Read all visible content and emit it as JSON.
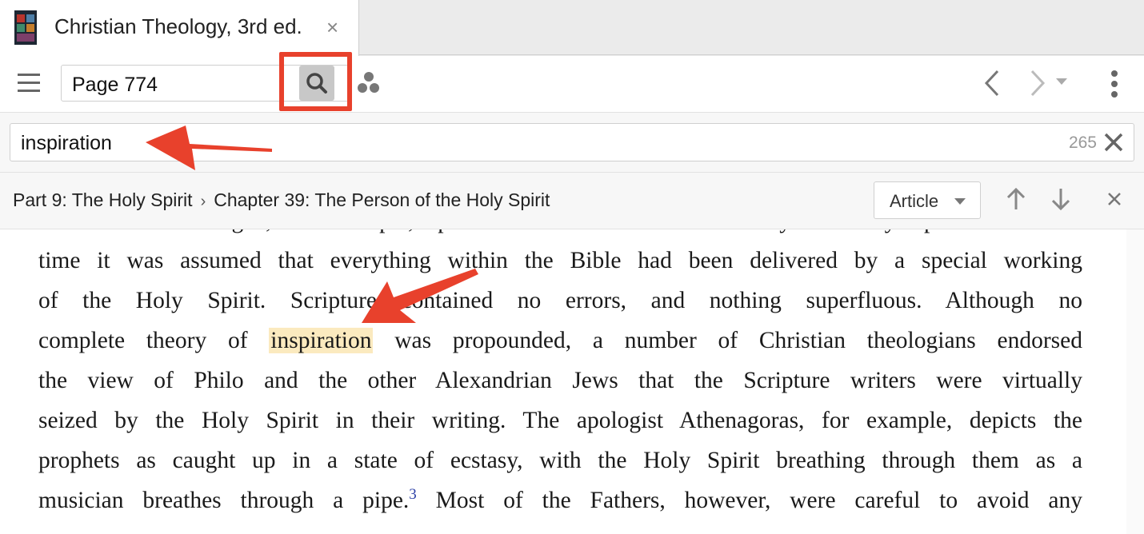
{
  "tab": {
    "title": "Christian Theology, 3rd ed.",
    "close_label": "×"
  },
  "toolbar": {
    "reference_value": "Page 774",
    "icons": [
      "menu-icon",
      "search-icon",
      "visual-filter-icon",
      "back-icon",
      "forward-icon",
      "history-dropdown-icon",
      "more-icon"
    ]
  },
  "search": {
    "query": "inspiration",
    "result_count": "265"
  },
  "breadcrumb": {
    "part": "Part 9: The Holy Spirit",
    "separator": "›",
    "chapter": "Chapter 39: The Person of the Holy Spirit",
    "view_mode": "Article"
  },
  "content": {
    "lines": [
      "Word of God. Origen, for example, spoke of the Bible as “written by the Holy Spirit.”  At that",
      "time it was assumed that everything within the Bible had been delivered by a special working",
      "of the Holy Spirit. Scripture contained no errors, and nothing superfluous. Although no"
    ],
    "line4_before": "complete theory of ",
    "highlight": "inspiration",
    "line4_after": " was propounded, a number of Christian theologians endorsed",
    "lines_b": [
      "the view of Philo and the other Alexandrian Jews that the Scripture writers were virtually",
      "seized by the Holy Spirit in their writing. The apologist Athenagoras, for example, depicts the",
      "prophets as caught up in a state of ecstasy, with the Holy Spirit breathing through them as a"
    ],
    "line8_before": "musician breathes through a pipe.",
    "footnote": "3",
    "line8_after": " Most of the Fathers, however, were careful to avoid any"
  },
  "colors": {
    "annotation_red": "#e8412c",
    "highlight": "#fbeabf",
    "footnote_link": "#2b3fa6"
  }
}
